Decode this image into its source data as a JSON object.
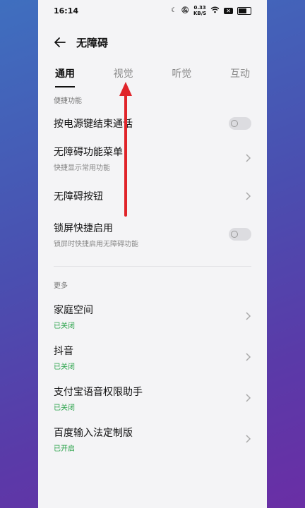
{
  "status_bar": {
    "time": "16:14",
    "net_speed": "0.33",
    "net_unit": "KB/S",
    "net_box": "✕",
    "icons": [
      "moon-icon",
      "bell-off-icon",
      "wifi-icon",
      "battery-icon"
    ]
  },
  "header": {
    "title": "无障碍",
    "back_icon": "arrow-left-icon"
  },
  "tabs": [
    {
      "label": "通用",
      "active": true
    },
    {
      "label": "视觉",
      "active": false
    },
    {
      "label": "听觉",
      "active": false
    },
    {
      "label": "互动",
      "active": false
    }
  ],
  "sections": {
    "shortcuts_label": "便捷功能",
    "more_label": "更多"
  },
  "shortcut_items": [
    {
      "title": "按电源键结束通话",
      "subtitle": "",
      "control": "toggle",
      "on": false
    },
    {
      "title": "无障碍功能菜单",
      "subtitle": "快捷显示常用功能",
      "control": "chevron"
    },
    {
      "title": "无障碍按钮",
      "subtitle": "",
      "control": "chevron"
    },
    {
      "title": "锁屏快捷启用",
      "subtitle": "锁屏时快捷启用无障碍功能",
      "control": "toggle",
      "on": false
    }
  ],
  "more_items": [
    {
      "title": "家庭空间",
      "status": "已关闭"
    },
    {
      "title": "抖音",
      "status": "已关闭"
    },
    {
      "title": "支付宝语音权限助手",
      "status": "已关闭"
    },
    {
      "title": "百度输入法定制版",
      "status": "已开启"
    }
  ],
  "colors": {
    "status_green": "#2aa34a",
    "annotation_red": "#e0242a"
  }
}
